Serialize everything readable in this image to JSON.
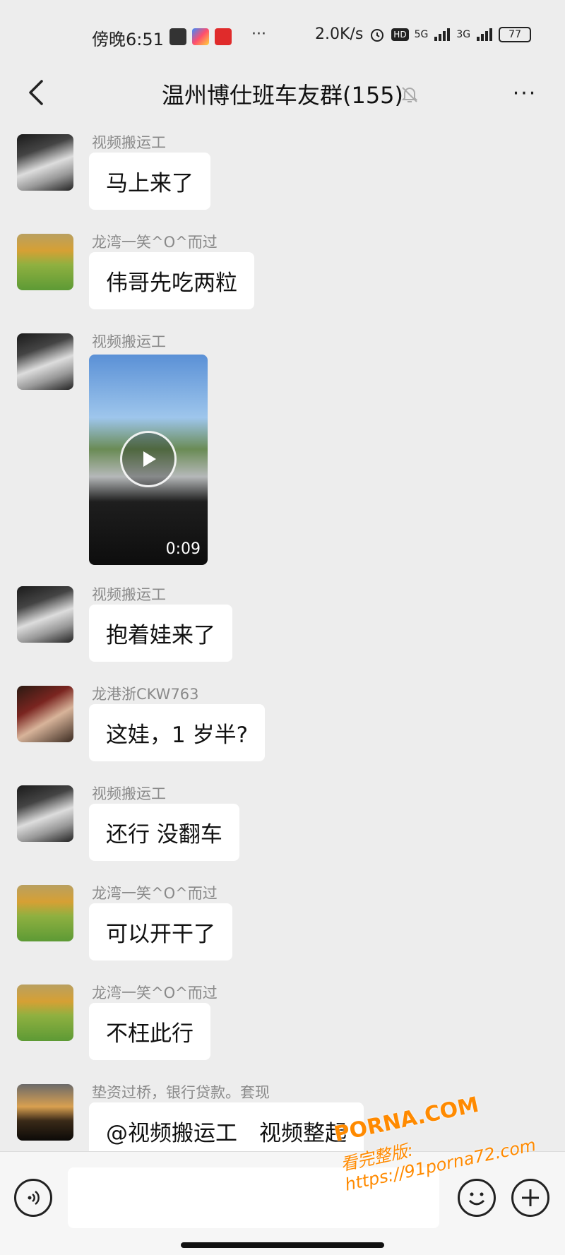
{
  "status_bar": {
    "time": "傍晚6:51",
    "ellipsis": "···",
    "network_speed": "2.0K/s",
    "signal_1": "5G",
    "signal_2": "3G",
    "battery": "77"
  },
  "header": {
    "title": "温州博仕班车友群(155)",
    "back_icon": "chevron-left-icon",
    "mute_icon": "bell-mute-icon",
    "more_icon": "more-icon",
    "more_label": "···"
  },
  "messages": [
    {
      "sender": "视频搬运工",
      "text": "马上来了",
      "avatar": "man-portrait"
    },
    {
      "sender": "龙湾一笑^O^而过",
      "text": "伟哥先吃两粒",
      "avatar": "child-garden"
    },
    {
      "sender": "视频搬运工",
      "type": "video",
      "duration": "0:09",
      "avatar": "man-portrait"
    },
    {
      "sender": "视频搬运工",
      "text": "抱着娃来了",
      "avatar": "man-portrait"
    },
    {
      "sender": "龙港浙CKW763",
      "text": "这娃，1 岁半?",
      "avatar": "car-interior"
    },
    {
      "sender": "视频搬运工",
      "text": "还行 没翻车",
      "avatar": "man-portrait"
    },
    {
      "sender": "龙湾一笑^O^而过",
      "text": "可以开干了",
      "avatar": "child-garden"
    },
    {
      "sender": "龙湾一笑^O^而过",
      "text": "不枉此行",
      "avatar": "child-garden"
    },
    {
      "sender": "垫资过桥，银行贷款。套现",
      "text": "@视频搬运工　视频整起",
      "avatar": "sunset-landscape"
    }
  ],
  "input_bar": {
    "voice_icon": "voice-icon",
    "emoji_icon": "emoji-icon",
    "plus_icon": "plus-icon"
  },
  "watermark": {
    "main": "PORNA.COM",
    "url": "看完整版: https://91porna72.com"
  },
  "colors": {
    "background": "#ededed",
    "bubble": "#ffffff",
    "sender_name": "#8a8a8a",
    "watermark": "#ff8a00"
  }
}
